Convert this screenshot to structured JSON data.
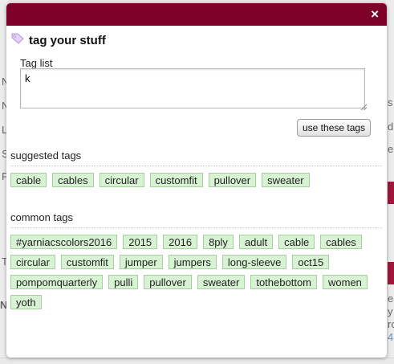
{
  "background": {
    "left_letters": [
      "N",
      "N",
      "L",
      "S",
      "F",
      "T",
      "N"
    ],
    "right_letters": [
      "s",
      "d",
      "e",
      "ea",
      "y",
      "ro",
      "4"
    ]
  },
  "modal": {
    "close_label": "×",
    "title": "tag your stuff",
    "tag_list_label": "Tag list",
    "tag_list_value": "k",
    "use_tags_button": "use these tags",
    "suggested_title": "suggested tags",
    "suggested_tags": [
      "cable",
      "cables",
      "circular",
      "customfit",
      "pullover",
      "sweater"
    ],
    "common_title": "common tags",
    "common_tags": [
      "#yarniacscolors2016",
      "2015",
      "2016",
      "8ply",
      "adult",
      "cable",
      "cables",
      "circular",
      "customfit",
      "jumper",
      "jumpers",
      "long-sleeve",
      "oct15",
      "pompomquarterly",
      "pulli",
      "pullover",
      "sweater",
      "tothebottom",
      "women",
      "yoth"
    ]
  },
  "colors": {
    "header": "#7c0027",
    "chip_bg": "#d8f2d4",
    "chip_border": "#a6cf9e",
    "tag_icon": "#c7a8e6"
  },
  "icons": {
    "tag_icon": "tag-icon",
    "close_icon": "close-icon"
  }
}
